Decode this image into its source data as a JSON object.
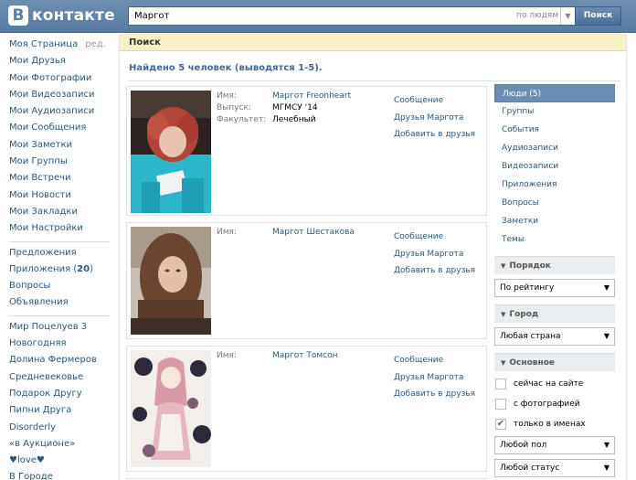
{
  "header": {
    "logo_letter": "В",
    "logo_text": "контакте",
    "search_value": "Маргот",
    "search_scope": "по людям",
    "search_button": "Поиск"
  },
  "nav": {
    "items": [
      {
        "label": "Моя Страница",
        "suffix": "ред."
      },
      {
        "label": "Мои Друзья"
      },
      {
        "label": "Мои Фотографии"
      },
      {
        "label": "Мои Видеозаписи"
      },
      {
        "label": "Мои Аудиозаписи"
      },
      {
        "label": "Мои Сообщения"
      },
      {
        "label": "Мои Заметки"
      },
      {
        "label": "Мои Группы"
      },
      {
        "label": "Мои Встречи"
      },
      {
        "label": "Мои Новости"
      },
      {
        "label": "Мои Закладки"
      },
      {
        "label": "Мои Настройки"
      }
    ],
    "group2": [
      {
        "label": "Предложения"
      },
      {
        "label": "Приложения (",
        "count": "20",
        "close": ")"
      },
      {
        "label": "Вопросы"
      },
      {
        "label": "Объявления"
      }
    ],
    "apps": [
      {
        "label": "Мир Поцелуев 3"
      },
      {
        "label": "Новогодняя"
      },
      {
        "label": "Долина Фермеров"
      },
      {
        "label": "Средневековье"
      },
      {
        "label": "Подарок Другу"
      },
      {
        "label": "Пипни Друга"
      },
      {
        "label": "Disorderly"
      },
      {
        "label": "«в Аукционе»"
      },
      {
        "label": "♥love♥"
      },
      {
        "label": "В Городе"
      }
    ]
  },
  "page": {
    "title": "Поиск",
    "summary": "Найдено 5 человек (выводятся 1-5)."
  },
  "results": [
    {
      "fields": [
        {
          "label": "Имя:",
          "value": "Маргот Freonheart",
          "link": true
        },
        {
          "label": "Выпуск:",
          "value": "МГМСУ '14",
          "link": false
        },
        {
          "label": "Факультет:",
          "value": "Лечебный",
          "link": false
        }
      ],
      "actions": [
        "Сообщение",
        "Друзья Маргота",
        "Добавить в друзья"
      ]
    },
    {
      "fields": [
        {
          "label": "Имя:",
          "value": "Маргот Шестакова",
          "link": true
        }
      ],
      "actions": [
        "Сообщение",
        "Друзья Маргота",
        "Добавить в друзья"
      ]
    },
    {
      "fields": [
        {
          "label": "Имя:",
          "value": "Маргот Томсон",
          "link": true
        }
      ],
      "actions": [
        "Сообщение",
        "Друзья Маргота",
        "Добавить в друзья"
      ]
    }
  ],
  "filters": {
    "tabs": [
      "Люди (5)",
      "Группы",
      "События",
      "Аудиозаписи",
      "Видеозаписи",
      "Приложения",
      "Вопросы",
      "Заметки",
      "Темы"
    ],
    "active_tab": "Люди (5)",
    "order_head": "Порядок",
    "order_value": "По рейтингу",
    "city_head": "Город",
    "city_value": "Любая страна",
    "basic_head": "Основное",
    "checks": [
      {
        "label": "сейчас на сайте",
        "checked": false
      },
      {
        "label": "с фотографией",
        "checked": false
      },
      {
        "label": "только в именах",
        "checked": true
      }
    ],
    "gender_value": "Любой пол",
    "status_value": "Любой статус"
  },
  "colors": {
    "header_blue": "#5b7fa6",
    "link_blue": "#2b587a",
    "page_bar_yellow": "#f7f0c6",
    "active_tab_blue": "#6c8db3"
  }
}
